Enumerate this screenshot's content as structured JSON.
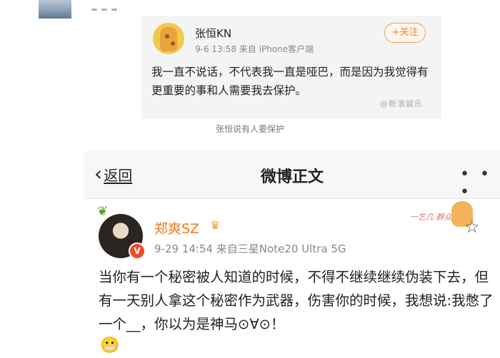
{
  "post_card": {
    "author": "张恒KN",
    "time_source": "9-6 13:58   来自 iPhone客户端",
    "follow_label": "+关注",
    "text": "我一直不说话，不代表我一直是哑巴，而是因为我觉得有更重要的事和人需要我去保护。",
    "watermark": "@新浪娱乐"
  },
  "caption": "张恒说有人要保护",
  "detail": {
    "back_label": "返回",
    "title": "微博正文",
    "more_label": "• • •",
    "author": "郑爽SZ",
    "verified_badge": "V",
    "time_source": "9-29 14:54   来自三星Note20 Ultra 5G",
    "deco_text": "一乞几 群众",
    "text": "当你有一个秘密被人知道的时候，不得不继续继续伪装下去，但有一天别人拿这个秘密作为武器，伤害你的时候，我想说:我憋了一个__，你以为是神马⊙∀⊙！",
    "icons": {
      "back": "chevron-left-icon",
      "more": "more-dots-icon",
      "star": "star-outline-icon",
      "crown": "crown-badge-icon",
      "emoji": "grin-emoji-icon"
    }
  }
}
